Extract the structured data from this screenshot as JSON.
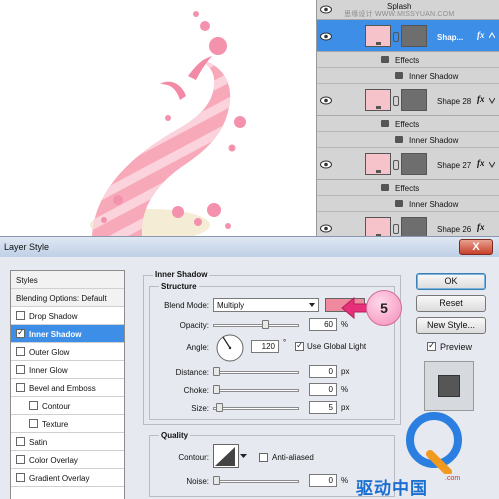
{
  "layers_panel": {
    "partial_top_label": "Splash",
    "layers": [
      {
        "name": "Shap...",
        "selected": true
      },
      {
        "name": "Shape 28",
        "selected": false
      },
      {
        "name": "Shape 27",
        "selected": false
      },
      {
        "name": "Shape 26",
        "selected": false
      }
    ],
    "effects_label": "Effects",
    "effect_item": "Inner Shadow",
    "fx_label": "fx"
  },
  "dialog": {
    "title": "Layer Style",
    "close_symbol": "X",
    "styles_list": [
      {
        "label": "Styles",
        "type": "header"
      },
      {
        "label": "Blending Options: Default",
        "type": "header"
      },
      {
        "label": "Drop Shadow",
        "checked": false,
        "indent": 0
      },
      {
        "label": "Inner Shadow",
        "checked": true,
        "indent": 0,
        "selected": true
      },
      {
        "label": "Outer Glow",
        "checked": false,
        "indent": 0
      },
      {
        "label": "Inner Glow",
        "checked": false,
        "indent": 0
      },
      {
        "label": "Bevel and Emboss",
        "checked": false,
        "indent": 0
      },
      {
        "label": "Contour",
        "checked": false,
        "indent": 1
      },
      {
        "label": "Texture",
        "checked": false,
        "indent": 1
      },
      {
        "label": "Satin",
        "checked": false,
        "indent": 0
      },
      {
        "label": "Color Overlay",
        "checked": false,
        "indent": 0
      },
      {
        "label": "Gradient Overlay",
        "checked": false,
        "indent": 0
      }
    ],
    "panel_title": "Inner Shadow",
    "structure": {
      "title": "Structure",
      "blend_mode_label": "Blend Mode:",
      "blend_mode_value": "Multiply",
      "shadow_color": "#ef8a9e",
      "opacity_label": "Opacity:",
      "opacity_value": "60",
      "opacity_level": 0.6,
      "angle_label": "Angle:",
      "angle_value": "120",
      "angle_unit": "°",
      "global_light_label": "Use Global Light",
      "global_light_checked": true,
      "distance_label": "Distance:",
      "distance_value": "0",
      "choke_label": "Choke:",
      "choke_value": "0",
      "size_label": "Size:",
      "size_value": "5",
      "px_unit": "px",
      "percent_unit": "%"
    },
    "quality": {
      "title": "Quality",
      "contour_label": "Contour:",
      "anti_aliased_label": "Anti-aliased",
      "anti_aliased_checked": false,
      "noise_label": "Noise:",
      "noise_value": "0"
    },
    "buttons": {
      "ok": "OK",
      "reset": "Reset",
      "new_style": "New Style...",
      "preview_label": "Preview",
      "preview_checked": true
    }
  },
  "callout_number": "5",
  "watermark": {
    "url": "思缘设计 WWW.MISSYUAN.COM",
    "logo_text": "驱动中国",
    "logo_sub": ".com"
  }
}
